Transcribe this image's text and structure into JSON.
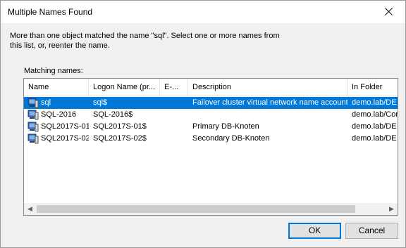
{
  "dialog": {
    "title": "Multiple Names Found",
    "message": "More than one object matched the name \"sql\". Select one or more names from this list, or, reenter the name.",
    "matching_label": "Matching names:"
  },
  "columns": [
    {
      "label": "Name"
    },
    {
      "label": "Logon Name (pr..."
    },
    {
      "label": "E-..."
    },
    {
      "label": "Description"
    },
    {
      "label": "In Folder"
    }
  ],
  "rows": [
    {
      "name": "sql",
      "logon": "sql$",
      "email": "",
      "description": "Failover cluster virtual network name account",
      "folder": "demo.lab/DE",
      "selected": true,
      "icon": "computer-icon"
    },
    {
      "name": "SQL-2016",
      "logon": "SQL-2016$",
      "email": "",
      "description": "",
      "folder": "demo.lab/Cor",
      "selected": false,
      "icon": "computer-icon"
    },
    {
      "name": "SQL2017S-01",
      "logon": "SQL2017S-01$",
      "email": "",
      "description": "Primary DB-Knoten",
      "folder": "demo.lab/DE",
      "selected": false,
      "icon": "computer-icon"
    },
    {
      "name": "SQL2017S-02",
      "logon": "SQL2017S-02$",
      "email": "",
      "description": "Secondary DB-Knoten",
      "folder": "demo.lab/DE",
      "selected": false,
      "icon": "computer-icon"
    }
  ],
  "buttons": {
    "ok": "OK",
    "cancel": "Cancel"
  },
  "colors": {
    "selection": "#0078d7",
    "dialog_bg": "#f0f0f0"
  }
}
